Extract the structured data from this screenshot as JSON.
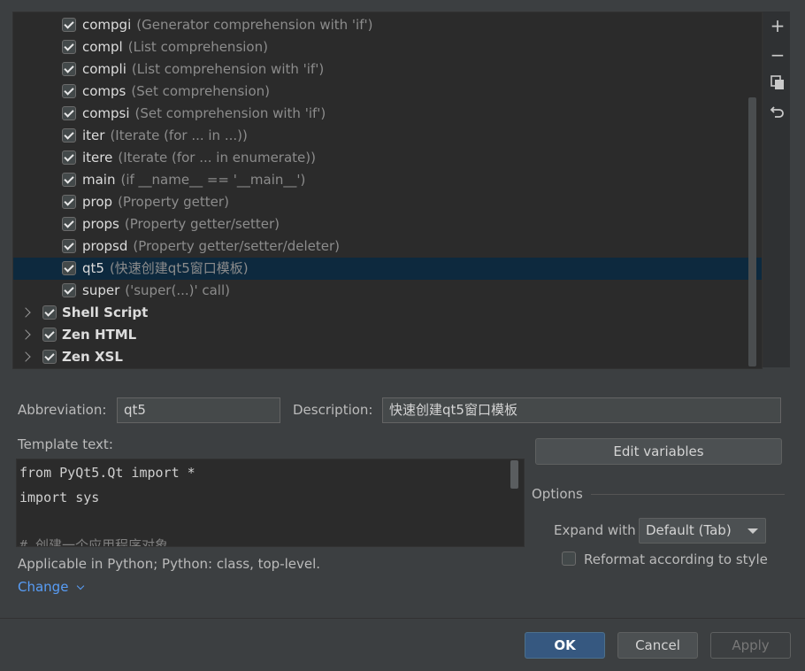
{
  "tree": {
    "items": [
      {
        "name": "compgi",
        "desc": "(Generator comprehension with 'if')",
        "checked": true
      },
      {
        "name": "compl",
        "desc": "(List comprehension)",
        "checked": true
      },
      {
        "name": "compli",
        "desc": "(List comprehension with 'if')",
        "checked": true
      },
      {
        "name": "comps",
        "desc": "(Set comprehension)",
        "checked": true
      },
      {
        "name": "compsi",
        "desc": "(Set comprehension with 'if')",
        "checked": true
      },
      {
        "name": "iter",
        "desc": "(Iterate (for ... in ...))",
        "checked": true
      },
      {
        "name": "itere",
        "desc": "(Iterate (for ... in enumerate))",
        "checked": true
      },
      {
        "name": "main",
        "desc": "(if __name__ == '__main__')",
        "checked": true
      },
      {
        "name": "prop",
        "desc": "(Property getter)",
        "checked": true
      },
      {
        "name": "props",
        "desc": "(Property getter/setter)",
        "checked": true
      },
      {
        "name": "propsd",
        "desc": "(Property getter/setter/deleter)",
        "checked": true
      },
      {
        "name": "qt5",
        "desc": "(快速创建qt5窗口模板)",
        "checked": true,
        "selected": true
      },
      {
        "name": "super",
        "desc": "('super(...)' call)",
        "checked": true
      }
    ],
    "groups": [
      {
        "name": "Shell Script",
        "checked": true
      },
      {
        "name": "Zen HTML",
        "checked": true
      },
      {
        "name": "Zen XSL",
        "checked": true
      }
    ]
  },
  "toolbar": {
    "icons": [
      "plus-icon",
      "minus-icon",
      "copy-icon",
      "undo-icon"
    ]
  },
  "form": {
    "abbreviation_label": "Abbreviation:",
    "abbreviation_value": "qt5",
    "description_label": "Description:",
    "description_value": "快速创建qt5窗口模板",
    "template_label": "Template text:",
    "template_lines": [
      "from PyQt5.Qt import *",
      "import sys",
      "",
      "# 创建一个应用程序对象"
    ],
    "edit_variables": "Edit variables",
    "options_label": "Options",
    "expand_label": "Expand with",
    "expand_value": "Default (Tab)",
    "reformat_label": "Reformat according to style",
    "applicable": "Applicable in Python; Python: class, top-level.",
    "change": "Change"
  },
  "buttons": {
    "ok": "OK",
    "cancel": "Cancel",
    "apply": "Apply"
  },
  "colors": {
    "selection": "#0d293e",
    "link": "#589df6",
    "primary": "#365880"
  }
}
